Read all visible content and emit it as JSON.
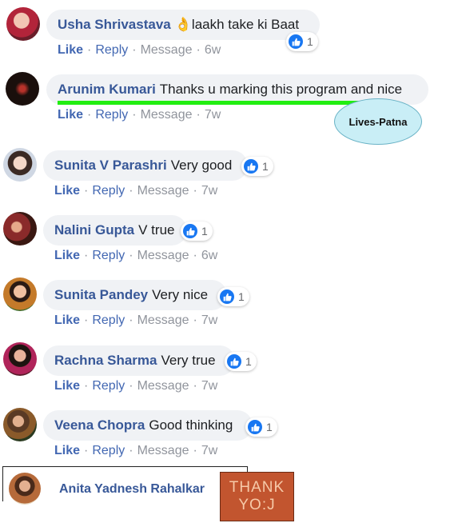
{
  "comments": [
    {
      "author": "Usha Shrivastava",
      "text": "👌laakh take ki Baat",
      "count": "1",
      "like": "Like",
      "reply": "Reply",
      "message": "Message",
      "time": "6w"
    },
    {
      "author": "Arunim Kumari",
      "text": "Thanks u marking this program and nice",
      "count": "",
      "like": "Like",
      "reply": "Reply",
      "message": "Message",
      "time": "7w"
    },
    {
      "author": "Sunita V Parashri",
      "text": "Very good",
      "count": "1",
      "like": "Like",
      "reply": "Reply",
      "message": "Message",
      "time": "7w"
    },
    {
      "author": "Nalini Gupta",
      "text": "V true",
      "count": "1",
      "like": "Like",
      "reply": "Reply",
      "message": "Message",
      "time": "6w"
    },
    {
      "author": "Sunita Pandey",
      "text": "Very nice",
      "count": "1",
      "like": "Like",
      "reply": "Reply",
      "message": "Message",
      "time": "7w"
    },
    {
      "author": "Rachna Sharma",
      "text": "Very true",
      "count": "1",
      "like": "Like",
      "reply": "Reply",
      "message": "Message",
      "time": "7w"
    },
    {
      "author": "Veena Chopra",
      "text": "Good thinking",
      "count": "1",
      "like": "Like",
      "reply": "Reply",
      "message": "Message",
      "time": "7w"
    }
  ],
  "annotation": {
    "label": "Lives-Patna",
    "line_color": "#22ee11"
  },
  "bottom": {
    "author": "Anita Yadnesh Rahalkar",
    "card_line1": "THANK",
    "card_line2": "YO:J"
  },
  "colors": {
    "name": "#385898",
    "action": "#4267b2",
    "like_badge": "#1877f2",
    "bubble": "#f0f2f5"
  },
  "icons": {
    "reaction": "thumbs-up-icon"
  }
}
